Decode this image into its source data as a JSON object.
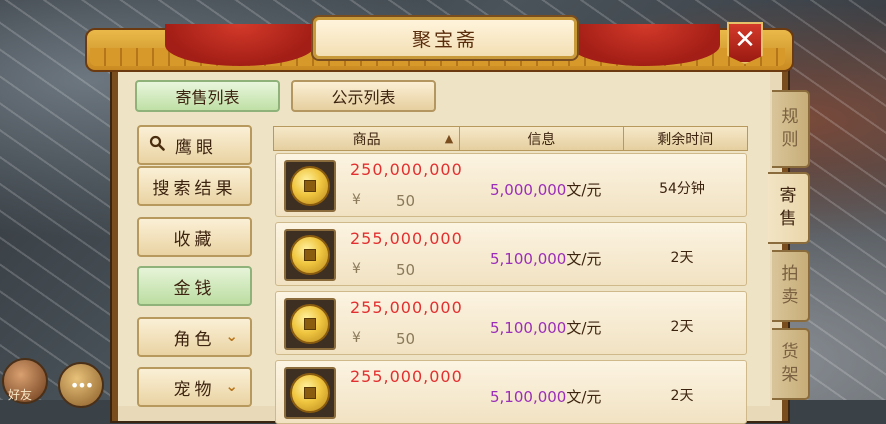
{
  "window": {
    "title": "聚宝斋",
    "close_label": "✕"
  },
  "top_tabs": [
    {
      "label": "寄售列表",
      "active": true
    },
    {
      "label": "公示列表",
      "active": false
    }
  ],
  "left_menu": {
    "eye_label": "鹰眼",
    "items": [
      {
        "label": "搜索结果",
        "active": false,
        "expandable": false
      },
      {
        "label": "收藏",
        "active": false,
        "expandable": false
      },
      {
        "label": "金钱",
        "active": true,
        "expandable": false
      },
      {
        "label": "角色",
        "active": false,
        "expandable": true
      },
      {
        "label": "宠物",
        "active": false,
        "expandable": true
      }
    ]
  },
  "table": {
    "columns": {
      "item": "商品",
      "info": "信息",
      "remaining": "剩余时间"
    },
    "sort_arrow": "▲",
    "rows": [
      {
        "amount": "250,000,000",
        "currency_symbol": "¥",
        "quantity": "50",
        "price_number": "5,000,000",
        "price_unit": "文/元",
        "remaining": "54分钟"
      },
      {
        "amount": "255,000,000",
        "currency_symbol": "¥",
        "quantity": "50",
        "price_number": "5,100,000",
        "price_unit": "文/元",
        "remaining": "2天"
      },
      {
        "amount": "255,000,000",
        "currency_symbol": "¥",
        "quantity": "50",
        "price_number": "5,100,000",
        "price_unit": "文/元",
        "remaining": "2天"
      },
      {
        "amount": "255,000,000",
        "currency_symbol": "",
        "quantity": "",
        "price_number": "5,100,000",
        "price_unit": "文/元",
        "remaining": "2天"
      }
    ]
  },
  "side_tabs": [
    {
      "label": "规则",
      "chars": [
        "规",
        "则"
      ],
      "active": false
    },
    {
      "label": "寄售",
      "chars": [
        "寄",
        "售"
      ],
      "active": true
    },
    {
      "label": "拍卖",
      "chars": [
        "拍",
        "卖"
      ],
      "active": false
    },
    {
      "label": "货架",
      "chars": [
        "货",
        "架"
      ],
      "active": false
    }
  ],
  "bottom_left": {
    "chat_glyph": "•••",
    "trade_label": "好友"
  },
  "colors": {
    "amount_red": "#e23030",
    "price_purple": "#9b2eb8",
    "active_green": "#bcdda2",
    "frame_brown": "#7a4d1f"
  },
  "icons": [
    "close-icon",
    "search-icon",
    "chevron-down-icon",
    "coin-icon",
    "sort-up-icon",
    "chat-icon",
    "trade-icon"
  ]
}
